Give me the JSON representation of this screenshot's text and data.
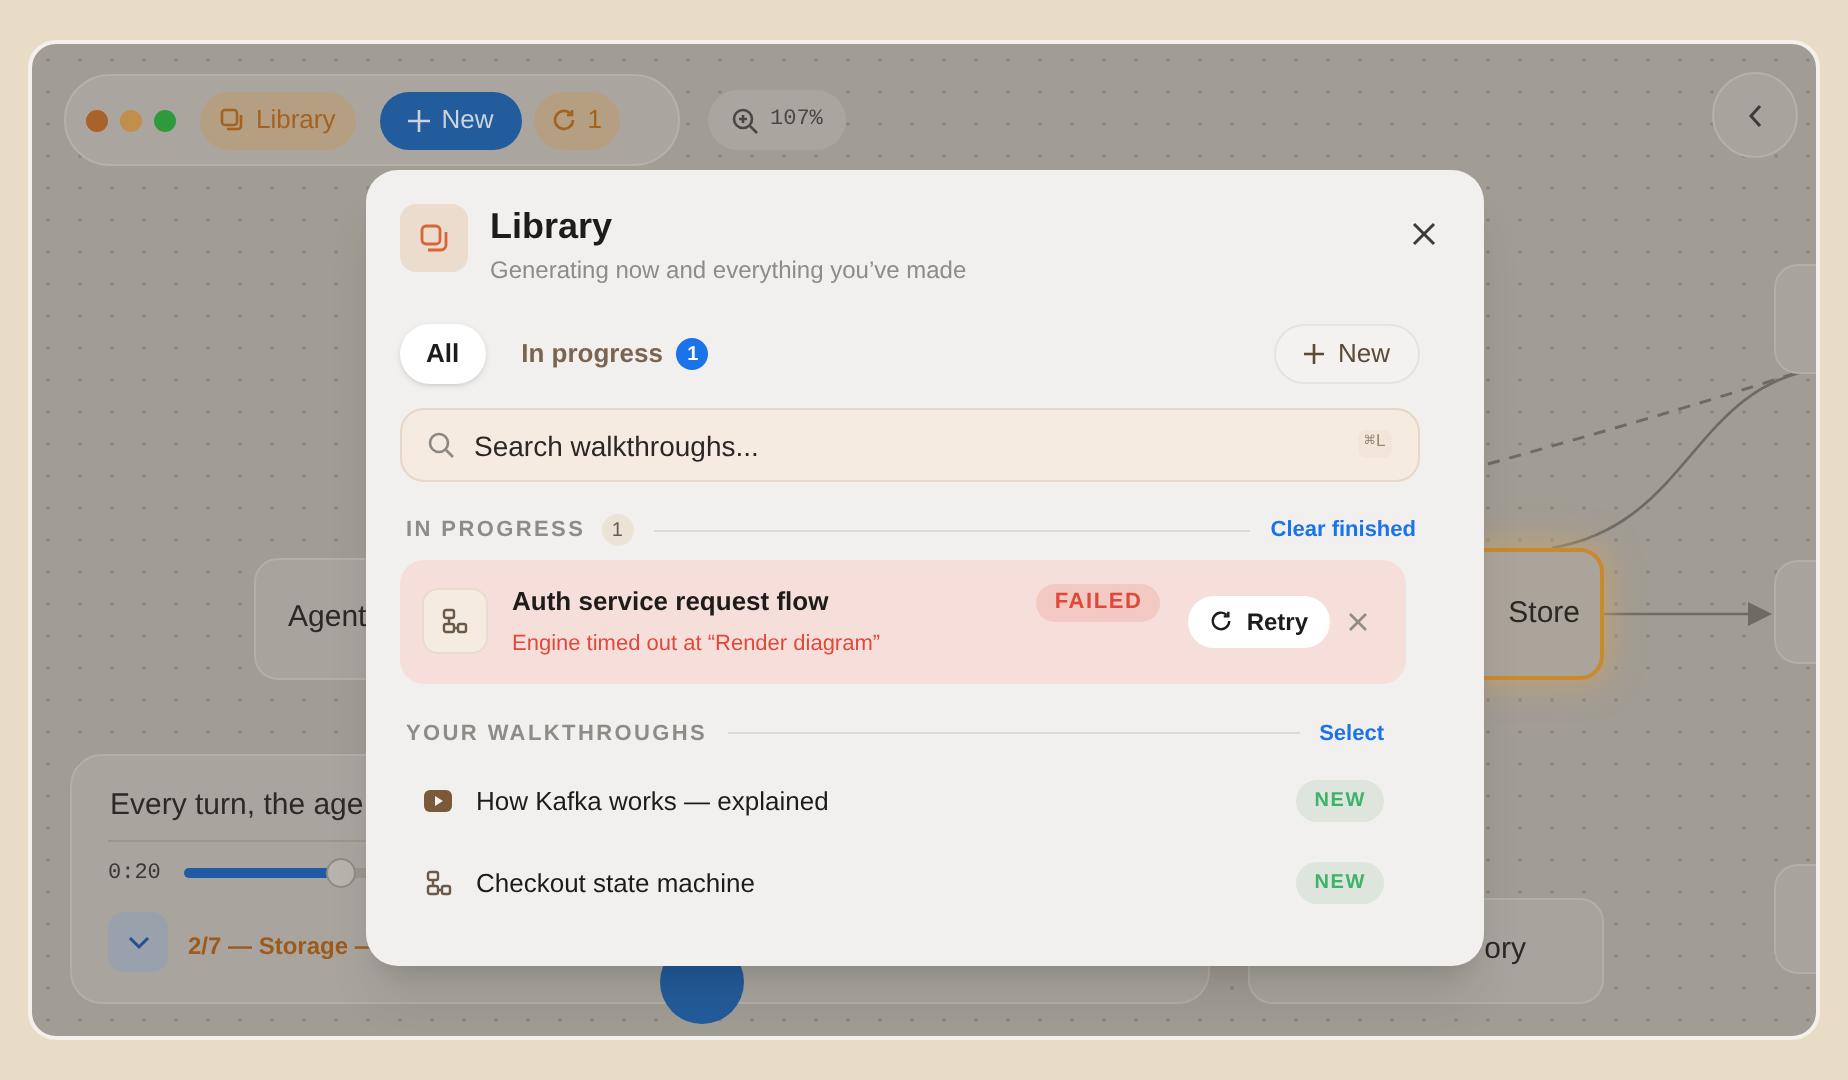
{
  "toolbar": {
    "library_button": "Library",
    "new_button": "New",
    "jobs_button": "1",
    "zoom_level": "107%"
  },
  "canvas": {
    "nodes": [
      {
        "label": "Agent",
        "selected": false
      },
      {
        "label": "Store",
        "selected": true
      },
      {
        "label": "ory",
        "selected": false
      }
    ]
  },
  "player": {
    "caption": "Every turn, the age",
    "elapsed": "0:20",
    "level": 0.17,
    "chapter": "2/7 — Storage —"
  },
  "library": {
    "title": "Library",
    "subtitle": "Generating now and everything you’ve made",
    "tabs": [
      {
        "label": "All",
        "selected": true
      },
      {
        "label": "In progress",
        "count": "1",
        "selected": false
      }
    ],
    "new_button": "New",
    "search": {
      "placeholder": "Search walkthroughs...",
      "shortcut": "⌘L"
    },
    "in_progress": {
      "heading": "IN PROGRESS",
      "count": "1",
      "action": "Clear finished",
      "items": [
        {
          "title": "Auth service request flow",
          "error": "Engine timed out at “Render diagram”",
          "status": "FAILED",
          "action": "Retry"
        }
      ]
    },
    "walkthroughs": {
      "heading": "YOUR WALKTHROUGHS",
      "action": "Select",
      "items": [
        {
          "kind": "video",
          "title": "How Kafka works — explained",
          "badge": "NEW"
        },
        {
          "kind": "diagram",
          "title": "Checkout state machine",
          "badge": "NEW"
        }
      ]
    }
  }
}
